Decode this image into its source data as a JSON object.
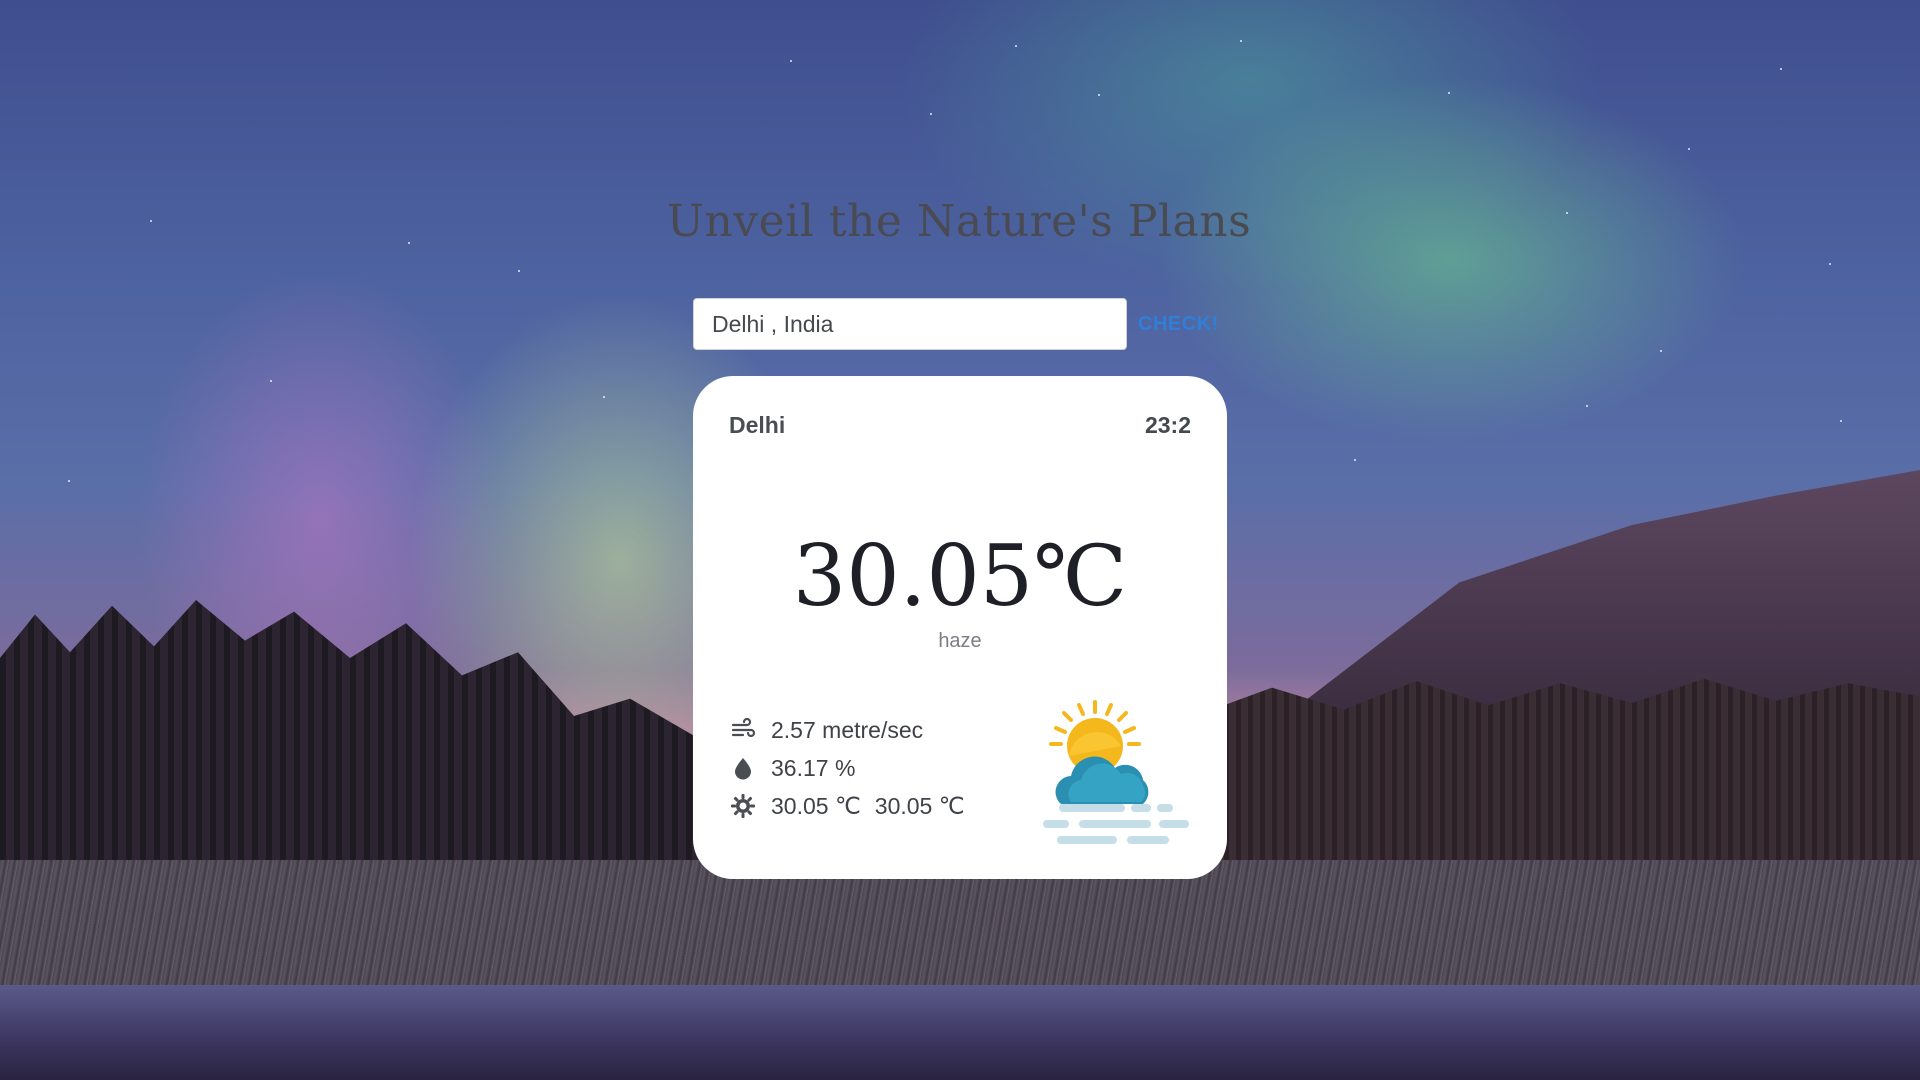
{
  "title": "Unveil the Nature's Plans",
  "search": {
    "value": "Delhi , India",
    "button_label": "CHECK!"
  },
  "card": {
    "city": "Delhi",
    "time": "23:2",
    "temperature": "30.05℃",
    "description": "haze",
    "wind": "2.57 metre/sec",
    "humidity": "36.17 %",
    "temp_min": "30.05 ℃",
    "temp_max": "30.05 ℃",
    "icons": {
      "wind": "wind-icon",
      "humidity": "droplet-icon",
      "temp": "sun-gear-icon",
      "weather": "sun-cloud-haze-icon"
    }
  },
  "colors": {
    "accent": "#2f7fd8",
    "card_bg": "#ffffff",
    "title": "#4a4a52"
  }
}
